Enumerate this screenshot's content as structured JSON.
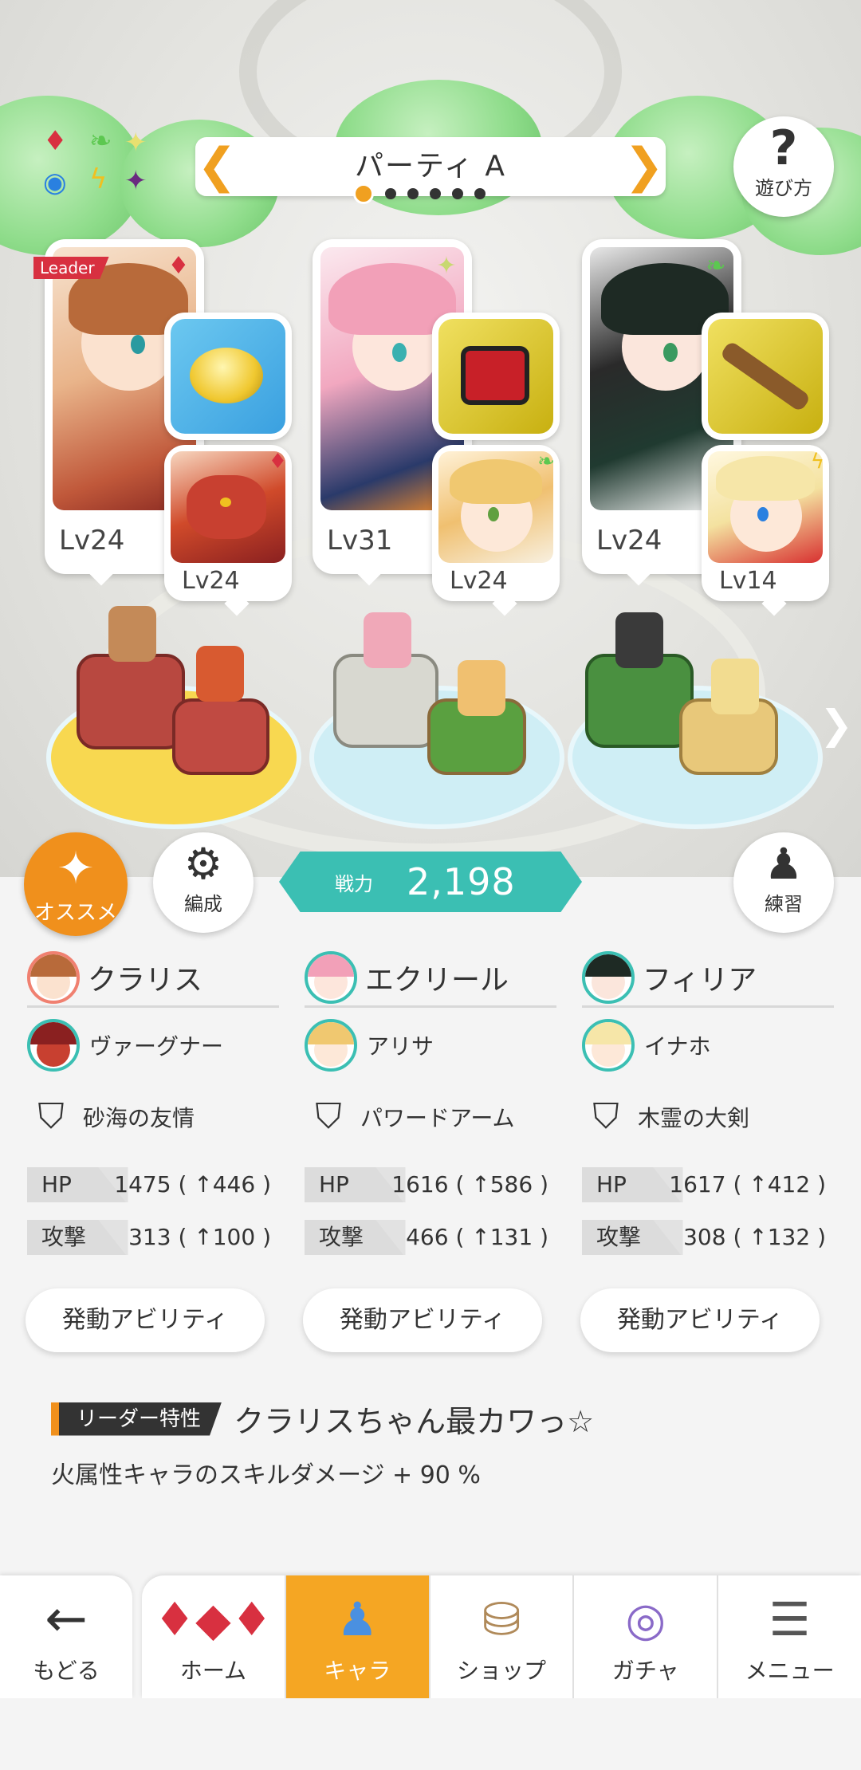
{
  "header": {
    "party_title": "パーティ A",
    "help_label": "遊び方",
    "help_glyph": "?",
    "element_icons": [
      "fire-diamond-icon",
      "leaf-icon",
      "sparkle-icon",
      "water-circle-icon",
      "lightning-icon",
      "dark-star-icon"
    ]
  },
  "units": [
    {
      "leader_label": "Leader",
      "main_level": "Lv24",
      "main_element": "fire",
      "equip_icon": "gold-bowl-icon",
      "sub_level": "Lv24",
      "sub_element": "fire"
    },
    {
      "main_level": "Lv31",
      "main_element": "light",
      "equip_icon": "red-armor-icon",
      "sub_level": "Lv24",
      "sub_element": "wind"
    },
    {
      "main_level": "Lv24",
      "main_element": "wind",
      "equip_icon": "wooden-sword-icon",
      "sub_level": "Lv14",
      "sub_element": "thunder"
    }
  ],
  "actions": {
    "recommend_label": "オススメ",
    "formation_label": "編成",
    "practice_label": "練習",
    "power_label": "戦力",
    "power_value": "2,198"
  },
  "stats": [
    {
      "main_name": "クラリス",
      "sub_name": "ヴァーグナー",
      "weapon": "砂海の友情",
      "hp_label": "HP",
      "hp_value": "1475 ( ↑446 )",
      "atk_label": "攻撃",
      "atk_value": "313 ( ↑100 )",
      "ability_label": "発動アビリティ"
    },
    {
      "main_name": "エクリール",
      "sub_name": "アリサ",
      "weapon": "パワードアーム",
      "hp_label": "HP",
      "hp_value": "1616 ( ↑586 )",
      "atk_label": "攻撃",
      "atk_value": "466 ( ↑131 )",
      "ability_label": "発動アビリティ"
    },
    {
      "main_name": "フィリア",
      "sub_name": "イナホ",
      "weapon": "木霊の大剣",
      "hp_label": "HP",
      "hp_value": "1617 ( ↑412 )",
      "atk_label": "攻撃",
      "atk_value": "308 ( ↑132 )",
      "ability_label": "発動アビリティ"
    }
  ],
  "leader_skill": {
    "tag": "リーダー特性",
    "title": "クラリスちゃん最カワっ☆",
    "description": "火属性キャラのスキルダメージ + 90 %"
  },
  "nav": {
    "back_label": "もどる",
    "tabs": [
      {
        "label": "ホーム",
        "icon": "home-gems-icon"
      },
      {
        "label": "キャラ",
        "icon": "character-figure-icon",
        "active": true
      },
      {
        "label": "ショップ",
        "icon": "shop-bags-icon"
      },
      {
        "label": "ガチャ",
        "icon": "gacha-portal-icon"
      },
      {
        "label": "メニュー",
        "icon": "menu-list-icon"
      }
    ]
  },
  "colors": {
    "accent_orange": "#f5a623",
    "power_teal": "#3bbfb3",
    "leader_red": "#d83040"
  }
}
